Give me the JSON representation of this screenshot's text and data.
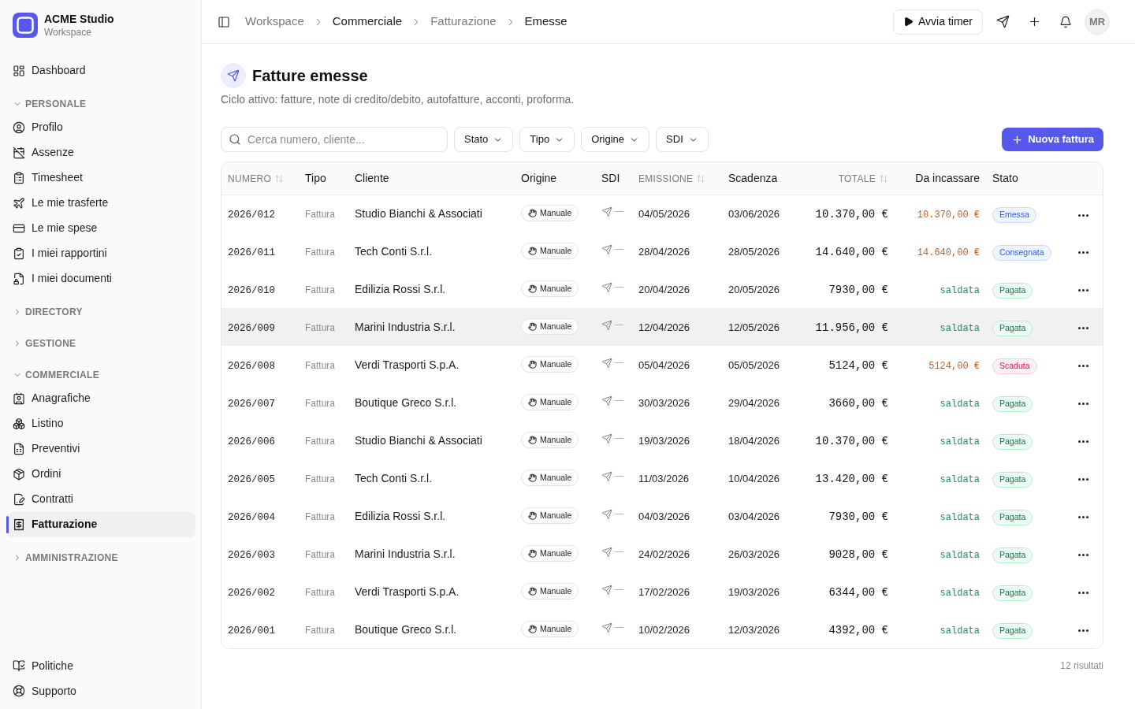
{
  "workspace": {
    "name": "ACME Studio",
    "subtitle": "Workspace"
  },
  "sidebar": {
    "top_items": [
      {
        "label": "Dashboard",
        "selected": false
      }
    ],
    "sections": [
      {
        "title": "PERSONALE",
        "expanded": true,
        "items": [
          {
            "label": "Profilo",
            "selected": false
          },
          {
            "label": "Assenze",
            "selected": false
          },
          {
            "label": "Timesheet",
            "selected": false
          },
          {
            "label": "Le mie trasferte",
            "selected": false
          },
          {
            "label": "Le mie spese",
            "selected": false
          },
          {
            "label": "I miei rapportini",
            "selected": false
          },
          {
            "label": "I miei documenti",
            "selected": false
          }
        ]
      },
      {
        "title": "DIRECTORY",
        "expanded": false
      },
      {
        "title": "GESTIONE",
        "expanded": false
      },
      {
        "title": "COMMERCIALE",
        "expanded": true,
        "items": [
          {
            "label": "Anagrafiche",
            "selected": false
          },
          {
            "label": "Listino",
            "selected": false
          },
          {
            "label": "Preventivi",
            "selected": false
          },
          {
            "label": "Ordini",
            "selected": false
          },
          {
            "label": "Contratti",
            "selected": false
          },
          {
            "label": "Fatturazione",
            "selected": true
          }
        ]
      },
      {
        "title": "AMMINISTRAZIONE",
        "expanded": false
      }
    ],
    "bottom_items": [
      {
        "label": "Politiche",
        "selected": false
      },
      {
        "label": "Supporto",
        "selected": false
      }
    ]
  },
  "breadcrumb": [
    {
      "label": "Workspace",
      "link": true
    },
    {
      "label": "Commerciale",
      "link": false
    },
    {
      "label": "Fatturazione",
      "link": true
    },
    {
      "label": "Emesse",
      "link": false
    }
  ],
  "header": {
    "timer_button": "Avvia timer",
    "avatar": "MR"
  },
  "page": {
    "title": "Fatture emesse",
    "subtitle": "Ciclo attivo: fatture, note di credito/debito, autofatture, acconti, proforma."
  },
  "toolbar": {
    "search": {
      "placeholder": "Cerca numero, cliente..."
    },
    "filters": [
      "Stato",
      "Tipo",
      "Origine",
      "SDI"
    ],
    "primary_button": "Nuova fattura"
  },
  "table": {
    "columns": [
      {
        "label": "NUMERO",
        "sortable": true
      },
      {
        "label": "Tipo",
        "sortable": false
      },
      {
        "label": "Cliente",
        "sortable": false
      },
      {
        "label": "Origine",
        "sortable": false
      },
      {
        "label": "SDI",
        "sortable": false
      },
      {
        "label": "EMISSIONE",
        "sortable": true
      },
      {
        "label": "Scadenza",
        "sortable": false
      },
      {
        "label": "TOTALE",
        "sortable": true
      },
      {
        "label": "Da incassare",
        "sortable": false
      },
      {
        "label": "Stato",
        "sortable": false
      }
    ],
    "rows": [
      {
        "number": "2026/012",
        "type": "Fattura",
        "client": "Studio Bianchi & Associati",
        "origin": "Manuale",
        "sdi": "—",
        "issued": "04/05/2026",
        "due_date": "03/06/2026",
        "total": "10.370,00 €",
        "due": {
          "text": "10.370,00 €",
          "kind": "open"
        },
        "status": {
          "label": "Emessa",
          "kind": "issued"
        },
        "hovered": false
      },
      {
        "number": "2026/011",
        "type": "Fattura",
        "client": "Tech Conti S.r.l.",
        "origin": "Manuale",
        "sdi": "—",
        "issued": "28/04/2026",
        "due_date": "28/05/2026",
        "total": "14.640,00 €",
        "due": {
          "text": "14.640,00 €",
          "kind": "open"
        },
        "status": {
          "label": "Consegnata",
          "kind": "delivered"
        },
        "hovered": false
      },
      {
        "number": "2026/010",
        "type": "Fattura",
        "client": "Edilizia Rossi S.r.l.",
        "origin": "Manuale",
        "sdi": "—",
        "issued": "20/04/2026",
        "due_date": "20/05/2026",
        "total": "7930,00 €",
        "due": {
          "text": "saldata",
          "kind": "settled"
        },
        "status": {
          "label": "Pagata",
          "kind": "paid"
        },
        "hovered": false
      },
      {
        "number": "2026/009",
        "type": "Fattura",
        "client": "Marini Industria S.r.l.",
        "origin": "Manuale",
        "sdi": "—",
        "issued": "12/04/2026",
        "due_date": "12/05/2026",
        "total": "11.956,00 €",
        "due": {
          "text": "saldata",
          "kind": "settled"
        },
        "status": {
          "label": "Pagata",
          "kind": "paid"
        },
        "hovered": true
      },
      {
        "number": "2026/008",
        "type": "Fattura",
        "client": "Verdi Trasporti S.p.A.",
        "origin": "Manuale",
        "sdi": "—",
        "issued": "05/04/2026",
        "due_date": "05/05/2026",
        "total": "5124,00 €",
        "due": {
          "text": "5124,00 €",
          "kind": "open"
        },
        "status": {
          "label": "Scaduta",
          "kind": "overdue"
        },
        "hovered": false
      },
      {
        "number": "2026/007",
        "type": "Fattura",
        "client": "Boutique Greco S.r.l.",
        "origin": "Manuale",
        "sdi": "—",
        "issued": "30/03/2026",
        "due_date": "29/04/2026",
        "total": "3660,00 €",
        "due": {
          "text": "saldata",
          "kind": "settled"
        },
        "status": {
          "label": "Pagata",
          "kind": "paid"
        },
        "hovered": false
      },
      {
        "number": "2026/006",
        "type": "Fattura",
        "client": "Studio Bianchi & Associati",
        "origin": "Manuale",
        "sdi": "—",
        "issued": "19/03/2026",
        "due_date": "18/04/2026",
        "total": "10.370,00 €",
        "due": {
          "text": "saldata",
          "kind": "settled"
        },
        "status": {
          "label": "Pagata",
          "kind": "paid"
        },
        "hovered": false
      },
      {
        "number": "2026/005",
        "type": "Fattura",
        "client": "Tech Conti S.r.l.",
        "origin": "Manuale",
        "sdi": "—",
        "issued": "11/03/2026",
        "due_date": "10/04/2026",
        "total": "13.420,00 €",
        "due": {
          "text": "saldata",
          "kind": "settled"
        },
        "status": {
          "label": "Pagata",
          "kind": "paid"
        },
        "hovered": false
      },
      {
        "number": "2026/004",
        "type": "Fattura",
        "client": "Edilizia Rossi S.r.l.",
        "origin": "Manuale",
        "sdi": "—",
        "issued": "04/03/2026",
        "due_date": "03/04/2026",
        "total": "7930,00 €",
        "due": {
          "text": "saldata",
          "kind": "settled"
        },
        "status": {
          "label": "Pagata",
          "kind": "paid"
        },
        "hovered": false
      },
      {
        "number": "2026/003",
        "type": "Fattura",
        "client": "Marini Industria S.r.l.",
        "origin": "Manuale",
        "sdi": "—",
        "issued": "24/02/2026",
        "due_date": "26/03/2026",
        "total": "9028,00 €",
        "due": {
          "text": "saldata",
          "kind": "settled"
        },
        "status": {
          "label": "Pagata",
          "kind": "paid"
        },
        "hovered": false
      },
      {
        "number": "2026/002",
        "type": "Fattura",
        "client": "Verdi Trasporti S.p.A.",
        "origin": "Manuale",
        "sdi": "—",
        "issued": "17/02/2026",
        "due_date": "19/03/2026",
        "total": "6344,00 €",
        "due": {
          "text": "saldata",
          "kind": "settled"
        },
        "status": {
          "label": "Pagata",
          "kind": "paid"
        },
        "hovered": false
      },
      {
        "number": "2026/001",
        "type": "Fattura",
        "client": "Boutique Greco S.r.l.",
        "origin": "Manuale",
        "sdi": "—",
        "issued": "10/02/2026",
        "due_date": "12/03/2026",
        "total": "4392,00 €",
        "due": {
          "text": "saldata",
          "kind": "settled"
        },
        "status": {
          "label": "Pagata",
          "kind": "paid"
        },
        "hovered": false
      }
    ]
  },
  "footer": {
    "count": "12 risultati"
  }
}
